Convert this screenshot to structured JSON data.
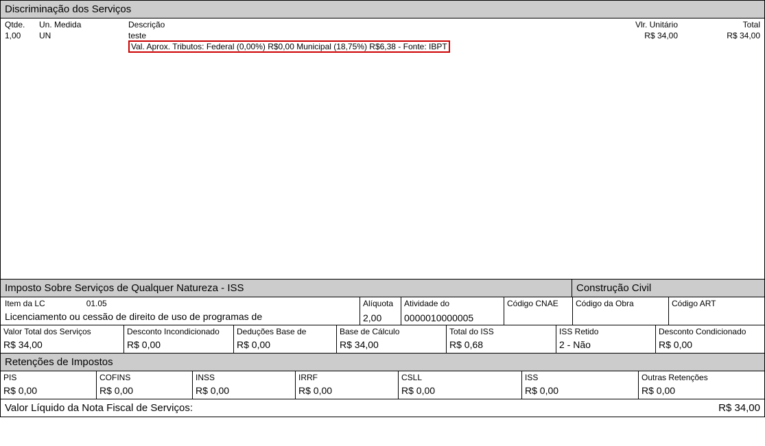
{
  "services": {
    "header": "Discriminação dos Serviços",
    "cols": {
      "qtde": "Qtde.",
      "un": "Un. Medida",
      "desc": "Descrição",
      "unit": "Vlr. Unitário",
      "total": "Total"
    },
    "row": {
      "qtde": "1,00",
      "un": "UN",
      "desc1": "teste",
      "desc2": "Val. Aprox. Tributos: Federal (0,00%) R$0,00 Municipal (18,75%) R$6,38  - Fonte: IBPT",
      "unit": "R$ 34,00",
      "total": "R$ 34,00"
    }
  },
  "iss": {
    "header_left": "Imposto Sobre Serviços de Qualquer Natureza - ISS",
    "header_right": "Construção Civil",
    "item_lc_label": "Item da LC",
    "item_lc_value": "01.05",
    "item_lc_desc": "Licenciamento ou cessão de direito de uso de programas de",
    "aliquota_label": "Alíquota",
    "aliquota_value": "2,00",
    "atividade_label": "Atividade do",
    "atividade_value": "0000010000005",
    "cnae_label": "Código CNAE",
    "obra_label": "Código da Obra",
    "art_label": "Código ART"
  },
  "values": {
    "total_serv_label": "Valor Total dos Serviços",
    "total_serv_value": "R$ 34,00",
    "desc_incond_label": "Desconto Incondicionado",
    "desc_incond_value": "R$ 0,00",
    "ded_label": "Deduções Base de",
    "ded_value": "R$ 0,00",
    "base_label": "Base de Cálculo",
    "base_value": "R$ 34,00",
    "total_iss_label": "Total do ISS",
    "total_iss_value": "R$ 0,68",
    "retido_label": "ISS Retido",
    "retido_value": "2 - Não",
    "desc_cond_label": "Desconto Condicionado",
    "desc_cond_value": "R$ 0,00"
  },
  "ret": {
    "header": "Retenções de Impostos",
    "pis_label": "PIS",
    "pis_value": "R$ 0,00",
    "cofins_label": "COFINS",
    "cofins_value": "R$ 0,00",
    "inss_label": "INSS",
    "inss_value": "R$ 0,00",
    "irrf_label": "IRRF",
    "irrf_value": "R$ 0,00",
    "csll_label": "CSLL",
    "csll_value": "R$ 0,00",
    "iss_label": "ISS",
    "iss_value": "R$ 0,00",
    "outras_label": "Outras Retenções",
    "outras_value": "R$ 0,00"
  },
  "liquido": {
    "label": "Valor Líquido da Nota Fiscal de Serviços:",
    "value": "R$ 34,00"
  }
}
